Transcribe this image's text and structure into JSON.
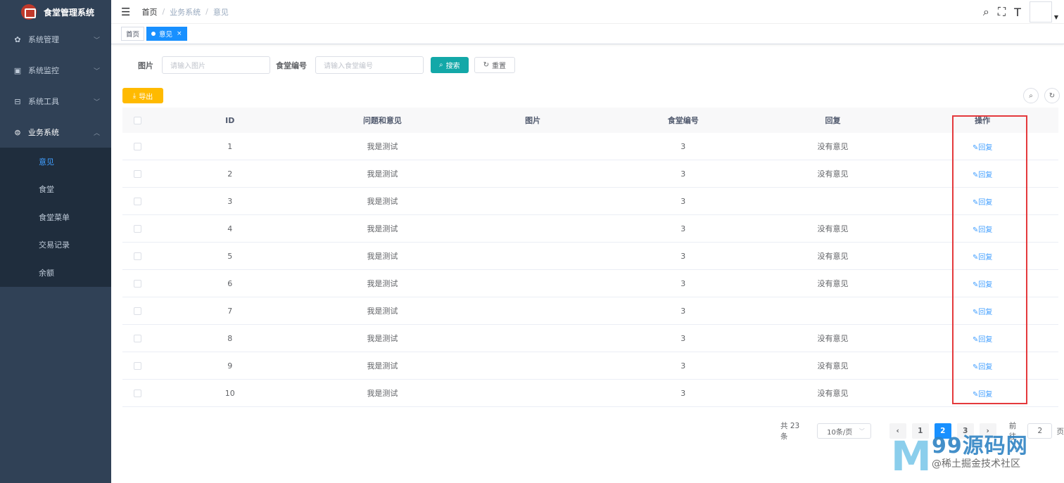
{
  "app": {
    "title": "食堂管理系统",
    "brand_color": "#304156",
    "accent": "#1890ff"
  },
  "sidebar": {
    "menus": [
      {
        "label": "系统管理",
        "icon": "gear-icon"
      },
      {
        "label": "系统监控",
        "icon": "monitor-icon"
      },
      {
        "label": "系统工具",
        "icon": "toolbox-icon"
      },
      {
        "label": "业务系统",
        "icon": "bus-icon",
        "open": true
      }
    ],
    "submenu": [
      "意见",
      "食堂",
      "食堂菜单",
      "交易记录",
      "余额"
    ],
    "active_sub": "意见"
  },
  "breadcrumb": [
    "首页",
    "业务系统",
    "意见"
  ],
  "tags": [
    {
      "label": "首页",
      "active": false
    },
    {
      "label": "意见",
      "active": true
    }
  ],
  "search": {
    "field1_label": "图片",
    "field1_placeholder": "请输入图片",
    "field2_label": "食堂编号",
    "field2_placeholder": "请输入食堂编号",
    "search_btn": "搜索",
    "reset_btn": "重置"
  },
  "toolbar": {
    "export_btn": "导出"
  },
  "table": {
    "columns": [
      "ID",
      "问题和意见",
      "图片",
      "食堂编号",
      "回复",
      "操作"
    ],
    "rows": [
      {
        "id": "1",
        "q": "我是测试",
        "img": "",
        "no": "3",
        "reply": "没有意见",
        "op": "回复"
      },
      {
        "id": "2",
        "q": "我是测试",
        "img": "",
        "no": "3",
        "reply": "没有意见",
        "op": "回复"
      },
      {
        "id": "3",
        "q": "我是测试",
        "img": "",
        "no": "3",
        "reply": "",
        "op": "回复"
      },
      {
        "id": "4",
        "q": "我是测试",
        "img": "",
        "no": "3",
        "reply": "没有意见",
        "op": "回复"
      },
      {
        "id": "5",
        "q": "我是测试",
        "img": "",
        "no": "3",
        "reply": "没有意见",
        "op": "回复"
      },
      {
        "id": "6",
        "q": "我是测试",
        "img": "",
        "no": "3",
        "reply": "没有意见",
        "op": "回复"
      },
      {
        "id": "7",
        "q": "我是测试",
        "img": "",
        "no": "3",
        "reply": "",
        "op": "回复"
      },
      {
        "id": "8",
        "q": "我是测试",
        "img": "",
        "no": "3",
        "reply": "没有意见",
        "op": "回复"
      },
      {
        "id": "9",
        "q": "我是测试",
        "img": "",
        "no": "3",
        "reply": "没有意见",
        "op": "回复"
      },
      {
        "id": "10",
        "q": "我是测试",
        "img": "",
        "no": "3",
        "reply": "没有意见",
        "op": "回复"
      }
    ]
  },
  "pagination": {
    "total": "共 23 条",
    "page_size": "10条/页",
    "pages": [
      "1",
      "2",
      "3"
    ],
    "current": "2",
    "goto_label": "前往",
    "goto_value": "2",
    "goto_suffix": "页"
  },
  "watermark": {
    "main": "99源码网",
    "sub": "@稀土掘金技术社区"
  }
}
